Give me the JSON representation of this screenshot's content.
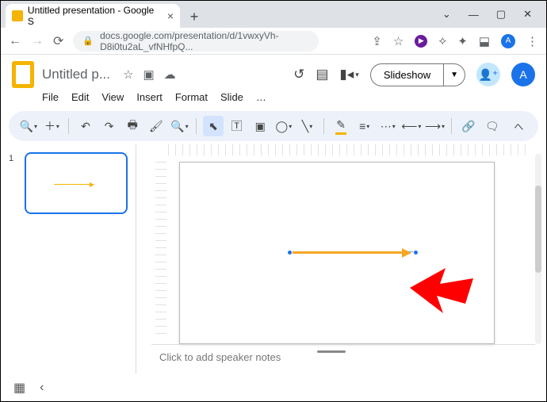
{
  "browser": {
    "tab_title": "Untitled presentation - Google S",
    "url": "docs.google.com/presentation/d/1vwxyVh-D8i0tu2aL_vfNHfpQ..."
  },
  "header": {
    "doc_title": "Untitled p...",
    "menus": [
      "File",
      "Edit",
      "View",
      "Insert",
      "Format",
      "Slide",
      "…"
    ],
    "slideshow_label": "Slideshow",
    "user_initial": "A"
  },
  "filmstrip": {
    "slides": [
      {
        "number": "1"
      }
    ]
  },
  "notes": {
    "placeholder": "Click to add speaker notes"
  },
  "canvas": {
    "selected_object": "arrow-line",
    "line_color": "#f5a623"
  }
}
